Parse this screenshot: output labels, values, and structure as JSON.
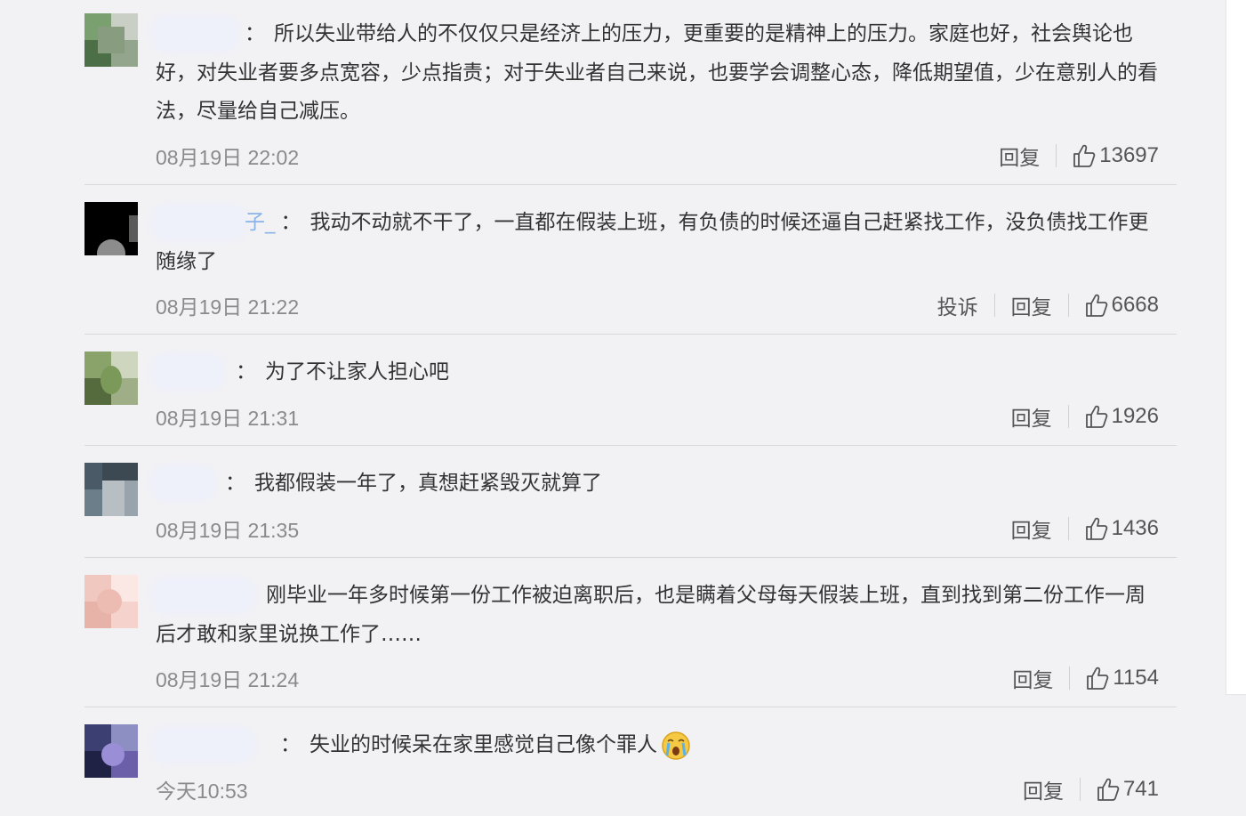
{
  "comments": [
    {
      "text": "所以失业带给人的不仅仅只是经济上的压力，更重要的是精神上的压力。家庭也好，社会舆论也好，对失业者要多点宽容，少点指责；对于失业者自己来说，也要学会调整心态，降低期望值，少在意别人的看法，尽量给自己减压。",
      "time": "08月19日 22:02",
      "reply": "回复",
      "likes": "13697"
    },
    {
      "name_tail": "子_",
      "text": "我动不动就不干了，一直都在假装上班，有负债的时候还逼自己赶紧找工作，没负债找工作更随缘了",
      "time": "08月19日 21:22",
      "report": "投诉",
      "reply": "回复",
      "likes": "6668"
    },
    {
      "text": "为了不让家人担心吧",
      "time": "08月19日 21:31",
      "reply": "回复",
      "likes": "1926"
    },
    {
      "text": "我都假装一年了，真想赶紧毁灭就算了",
      "time": "08月19日 21:35",
      "reply": "回复",
      "likes": "1436"
    },
    {
      "text": "刚毕业一年多时候第一份工作被迫离职后，也是瞒着父母每天假装上班，直到找到第二份工作一周后才敢和家里说换工作了……",
      "time": "08月19日 21:24",
      "reply": "回复",
      "likes": "1154"
    },
    {
      "text": "失业的时候呆在家里感觉自己像个罪人",
      "emoji": "crying-emoji",
      "time": "今天10:53",
      "reply": "回复",
      "likes": "741"
    }
  ],
  "colon": "：",
  "colors": {
    "background": "#f2f2f5",
    "text": "#333333",
    "meta": "#8a8a8a",
    "divider": "#d9d9d9"
  }
}
